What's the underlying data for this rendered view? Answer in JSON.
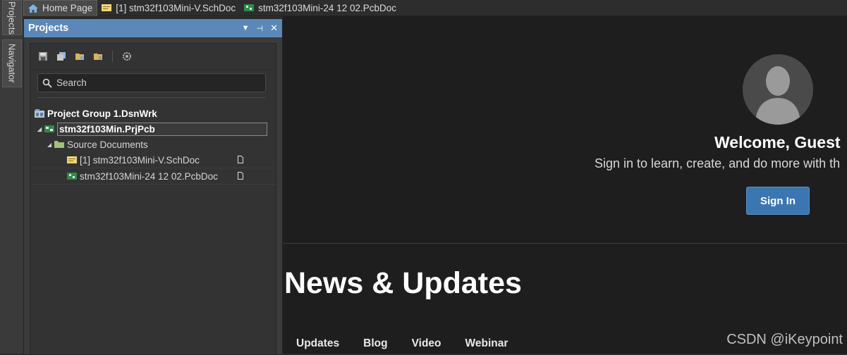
{
  "side_tabs": {
    "projects": "Projects",
    "navigator": "Navigator"
  },
  "tabs": [
    {
      "label": "Home Page"
    },
    {
      "label": "[1] stm32f103Mini-V.SchDoc"
    },
    {
      "label": "stm32f103Mini-24 12 02.PcbDoc"
    }
  ],
  "panel": {
    "title": "Projects",
    "search_placeholder": "Search",
    "tree": {
      "group": "Project Group 1.DsnWrk",
      "project": "stm32f103Min.PrjPcb",
      "folder": "Source Documents",
      "docs": [
        {
          "label": "[1] stm32f103Mini-V.SchDoc"
        },
        {
          "label": "stm32f103Mini-24 12 02.PcbDoc"
        }
      ]
    }
  },
  "home": {
    "welcome": "Welcome, Guest",
    "subtitle": "Sign in to learn, create, and do more with th",
    "signin": "Sign In",
    "news_title": "News & Updates",
    "news_tabs": [
      "Updates",
      "Blog",
      "Video",
      "Webinar"
    ]
  },
  "watermark": "CSDN @iKeypoint",
  "colors": {
    "panel_header": "#5b88b8",
    "signin_button": "#3b76b0"
  }
}
